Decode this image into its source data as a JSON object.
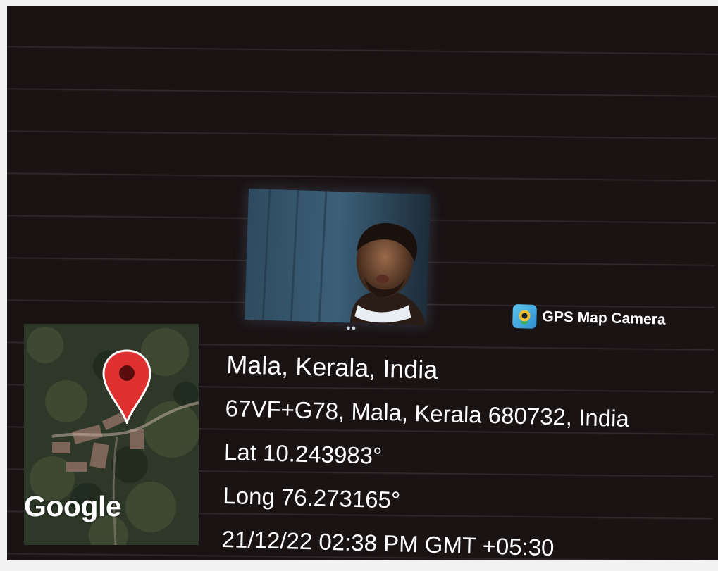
{
  "app_badge": {
    "label": "GPS Map Camera",
    "icon": "gps-map-camera-app-icon"
  },
  "map": {
    "attribution": "Google",
    "marker_icon": "location-pin-icon",
    "marker_color": "#e03131"
  },
  "location": {
    "place": "Mala, Kerala, India",
    "address": "67VF+G78, Mala, Kerala 680732, India",
    "latitude": "Lat 10.243983°",
    "longitude": "Long 76.273165°",
    "timestamp": "21/12/22 02:38 PM GMT +05:30"
  },
  "colors": {
    "background": "#1a1314",
    "text": "#ffffff",
    "badge_accent": "#2e8fcf"
  }
}
